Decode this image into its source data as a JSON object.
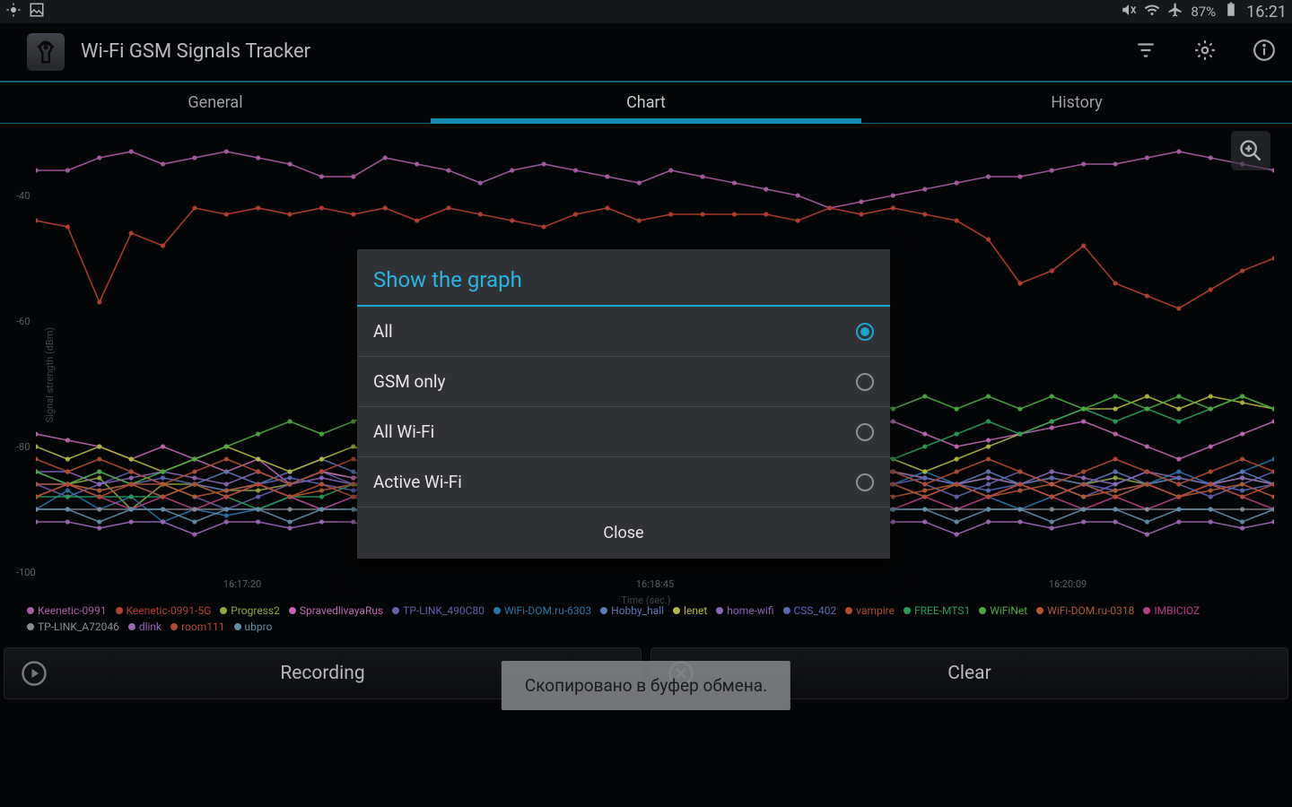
{
  "status": {
    "battery_pct": "87%",
    "time": "16:21"
  },
  "app": {
    "title": "Wi-Fi GSM Signals Tracker"
  },
  "tabs": {
    "general": "General",
    "chart": "Chart",
    "history": "History",
    "active": "chart"
  },
  "dialog": {
    "title": "Show the graph",
    "options": [
      "All",
      "GSM only",
      "All Wi-Fi",
      "Active Wi-Fi"
    ],
    "selected": 0,
    "close": "Close"
  },
  "buttons": {
    "record": "Recording",
    "clear": "Clear"
  },
  "toast": "Скопировано в буфер обмена.",
  "chart_data": {
    "type": "line",
    "xlabel": "Time (sec.)",
    "ylabel": "Signal strength (dBm)",
    "ylim": [
      -100,
      -30
    ],
    "yticks": [
      -40,
      -60,
      -80,
      -100
    ],
    "xticks": [
      "16:17:20",
      "16:18:45",
      "16:20:09"
    ],
    "series": [
      {
        "name": "Keenetic-0991",
        "color": "#c86fc1",
        "values": [
          -36,
          -36,
          -34,
          -33,
          -35,
          -34,
          -33,
          -34,
          -35,
          -37,
          -37,
          -34,
          -35,
          -36,
          -38,
          -36,
          -35,
          -36,
          -37,
          -38,
          -36,
          -37,
          -38,
          -39,
          -40,
          -42,
          -41,
          -40,
          -39,
          -38,
          -37,
          -37,
          -36,
          -35,
          -35,
          -34,
          -33,
          -34,
          -35,
          -36
        ]
      },
      {
        "name": "Keenetic-0991-5G",
        "color": "#d84b3a",
        "values": [
          -44,
          -45,
          -57,
          -46,
          -48,
          -42,
          -43,
          -42,
          -43,
          -42,
          -43,
          -42,
          -44,
          -42,
          -43,
          -44,
          -45,
          -43,
          -42,
          -44,
          -43,
          -43,
          -43,
          -43,
          -44,
          -42,
          -43,
          -42,
          -43,
          -44,
          -47,
          -54,
          -52,
          -48,
          -54,
          -56,
          -58,
          -55,
          -52,
          -50
        ]
      },
      {
        "name": "Progress2",
        "color": "#a8c84a",
        "values": [
          -88,
          -86,
          -85,
          -90,
          -86,
          -86,
          -87,
          -87,
          -86,
          -84,
          -85,
          -84,
          -85,
          -86,
          -85,
          -86,
          -87,
          -86,
          -85,
          -86,
          -85,
          -86,
          -87,
          -86,
          -85,
          -86,
          -85,
          -84,
          -85,
          -86,
          -85,
          -86,
          -85,
          -86,
          -85,
          -86,
          -85,
          -86,
          -85,
          -86
        ]
      },
      {
        "name": "SpravedlivayaRus",
        "color": "#e07ad2",
        "values": [
          -78,
          -79,
          -80,
          -82,
          -80,
          -82,
          -84,
          -82,
          -86,
          -84,
          -85,
          -84,
          -85,
          -86,
          -85,
          -86,
          -85,
          -86,
          -85,
          -86,
          -85,
          -84,
          -83,
          -82,
          -80,
          -78,
          -77,
          -76,
          -78,
          -80,
          -79,
          -78,
          -77,
          -76,
          -78,
          -80,
          -82,
          -80,
          -78,
          -76
        ]
      },
      {
        "name": "TP-LINK_490C80",
        "color": "#7a6fc8",
        "values": [
          -86,
          -88,
          -86,
          -84,
          -86,
          -88,
          -90,
          -88,
          -86,
          -84,
          -86,
          -88,
          -86,
          -88,
          -86,
          -84,
          -86,
          -88,
          -86,
          -84,
          -86,
          -88,
          -86,
          -84,
          -86,
          -84,
          -82,
          -84,
          -86,
          -88,
          -86,
          -84,
          -86,
          -88,
          -86,
          -84,
          -86,
          -88,
          -86,
          -84
        ]
      },
      {
        "name": "WiFi-DOM.ru-6303",
        "color": "#2f8ac8",
        "values": [
          -90,
          -87,
          -90,
          -88,
          -92,
          -90,
          -91,
          -90,
          -88,
          -90,
          -88,
          -86,
          -88,
          -90,
          -88,
          -90,
          -88,
          -86,
          -88,
          -90,
          -92,
          -90,
          -88,
          -90,
          -88,
          -86,
          -88,
          -86,
          -84,
          -86,
          -88,
          -90,
          -88,
          -86,
          -88,
          -86,
          -84,
          -86,
          -84,
          -82
        ]
      },
      {
        "name": "Hobby_hall",
        "color": "#6f8cd6",
        "values": [
          -84,
          -86,
          -84,
          -86,
          -88,
          -86,
          -84,
          -86,
          -84,
          -82,
          -84,
          -86,
          -88,
          -86,
          -84,
          -86,
          -88,
          -86,
          -84,
          -86,
          -88,
          -86,
          -84,
          -86,
          -88,
          -86,
          -84,
          -86,
          -88,
          -86,
          -84,
          -86,
          -88,
          -86,
          -84,
          -86,
          -88,
          -86,
          -84,
          -86
        ]
      },
      {
        "name": "lenet",
        "color": "#d0d84a",
        "values": [
          -80,
          -82,
          -80,
          -82,
          -84,
          -82,
          -80,
          -82,
          -84,
          -82,
          -80,
          -82,
          -84,
          -82,
          -80,
          -82,
          -84,
          -82,
          -80,
          -82,
          -84,
          -82,
          -80,
          -82,
          -84,
          -82,
          -80,
          -82,
          -84,
          -82,
          -80,
          -78,
          -76,
          -74,
          -74,
          -72,
          -74,
          -72,
          -73,
          -74
        ]
      },
      {
        "name": "home-wifi",
        "color": "#a27ad6",
        "values": [
          -84,
          -84,
          -86,
          -85,
          -84,
          -85,
          -86,
          -84,
          -86,
          -85,
          -86,
          -85,
          -84,
          -85,
          -86,
          -84,
          -85,
          -86,
          -85,
          -86,
          -84,
          -85,
          -84,
          -85,
          -84,
          -85,
          -86,
          -84,
          -85,
          -86,
          -85,
          -86,
          -84,
          -85,
          -86,
          -84,
          -85,
          -86,
          -85,
          -86
        ]
      },
      {
        "name": "CSS_402",
        "color": "#6c7ad8",
        "values": [
          -86,
          -86,
          -87,
          -86,
          -85,
          -86,
          -87,
          -86,
          -85,
          -86,
          -87,
          -86,
          -85,
          -86,
          -87,
          -86,
          -85,
          -86,
          -87,
          -86,
          -85,
          -86,
          -87,
          -86,
          -85,
          -86,
          -87,
          -86,
          -85,
          -86,
          -87,
          -86,
          -85,
          -86,
          -87,
          -86,
          -85,
          -86,
          -87,
          -86
        ]
      },
      {
        "name": "vampire",
        "color": "#d05a3a",
        "values": [
          -82,
          -84,
          -82,
          -84,
          -86,
          -84,
          -82,
          -84,
          -86,
          -84,
          -82,
          -84,
          -86,
          -84,
          -82,
          -84,
          -86,
          -84,
          -82,
          -84,
          -86,
          -84,
          -82,
          -84,
          -86,
          -84,
          -82,
          -84,
          -86,
          -84,
          -82,
          -84,
          -86,
          -84,
          -82,
          -84,
          -86,
          -84,
          -82,
          -84
        ]
      },
      {
        "name": "FREE-MTS1",
        "color": "#2fb86a",
        "values": [
          -88,
          -88,
          -88,
          -88,
          -88,
          -86,
          -88,
          -90,
          -88,
          -88,
          -86,
          -88,
          -88,
          -90,
          -88,
          -88,
          -88,
          -90,
          -88,
          -88,
          -88,
          -86,
          -84,
          -86,
          -84,
          -82,
          -80,
          -82,
          -80,
          -78,
          -76,
          -78,
          -76,
          -74,
          -76,
          -74,
          -76,
          -74,
          -72,
          -74
        ]
      },
      {
        "name": "WiFiNet",
        "color": "#58c84a",
        "values": [
          -84,
          -86,
          -84,
          -86,
          -84,
          -82,
          -80,
          -78,
          -76,
          -78,
          -76,
          -74,
          -76,
          -78,
          -76,
          -74,
          -76,
          -78,
          -76,
          -74,
          -76,
          -74,
          -76,
          -74,
          -76,
          -74,
          -72,
          -74,
          -72,
          -74,
          -72,
          -74,
          -72,
          -74,
          -72,
          -74,
          -72,
          -74,
          -72,
          -74
        ]
      },
      {
        "name": "WiFi-DOM.ru-0318",
        "color": "#d06a3a",
        "values": [
          -86,
          -86,
          -87,
          -86,
          -86,
          -88,
          -87,
          -86,
          -88,
          -87,
          -86,
          -86,
          -88,
          -87,
          -86,
          -88,
          -87,
          -86,
          -88,
          -87,
          -86,
          -88,
          -87,
          -86,
          -88,
          -87,
          -86,
          -88,
          -87,
          -86,
          -88,
          -87,
          -86,
          -88,
          -87,
          -86,
          -88,
          -87,
          -86,
          -88
        ]
      },
      {
        "name": "IMBICIOZ",
        "color": "#d84a9a",
        "values": [
          -88,
          -86,
          -88,
          -90,
          -88,
          -90,
          -88,
          -86,
          -88,
          -90,
          -88,
          -90,
          -88,
          -86,
          -88,
          -90,
          -88,
          -90,
          -88,
          -86,
          -88,
          -90,
          -88,
          -90,
          -88,
          -86,
          -88,
          -90,
          -88,
          -90,
          -88,
          -86,
          -88,
          -90,
          -88,
          -90,
          -88,
          -86,
          -88,
          -90
        ]
      },
      {
        "name": "TP-LINK_A72046",
        "color": "#a0a6ae",
        "values": [
          -90,
          -90,
          -90,
          -90,
          -90,
          -90,
          -90,
          -90,
          -90,
          -90,
          -90,
          -90,
          -90,
          -90,
          -90,
          -90,
          -90,
          -90,
          -90,
          -90,
          -90,
          -90,
          -90,
          -90,
          -90,
          -90,
          -90,
          -90,
          -90,
          -90,
          -90,
          -90,
          -90,
          -90,
          -90,
          -90,
          -90,
          -90,
          -90,
          -90
        ]
      },
      {
        "name": "dlink",
        "color": "#b87ad6",
        "values": [
          -92,
          -92,
          -93,
          -92,
          -92,
          -94,
          -92,
          -92,
          -93,
          -92,
          -92,
          -94,
          -92,
          -92,
          -93,
          -92,
          -92,
          -94,
          -92,
          -92,
          -93,
          -92,
          -92,
          -94,
          -92,
          -92,
          -93,
          -92,
          -92,
          -94,
          -92,
          -92,
          -93,
          -92,
          -92,
          -94,
          -92,
          -92,
          -93,
          -92
        ]
      },
      {
        "name": "room111",
        "color": "#d05a3a",
        "values": [
          -88,
          -86,
          -88,
          -86,
          -88,
          -86,
          -88,
          -86,
          -88,
          -86,
          -88,
          -86,
          -88,
          -86,
          -88,
          -86,
          -88,
          -86,
          -88,
          -86,
          -88,
          -86,
          -88,
          -86,
          -88,
          -86,
          -88,
          -86,
          -88,
          -86,
          -88,
          -86,
          -88,
          -86,
          -88,
          -86,
          -88,
          -86,
          -88,
          -86
        ]
      },
      {
        "name": "ubpro",
        "color": "#6fa8c8",
        "values": [
          -90,
          -90,
          -92,
          -90,
          -90,
          -92,
          -90,
          -90,
          -92,
          -90,
          -90,
          -92,
          -90,
          -90,
          -92,
          -90,
          -90,
          -92,
          -90,
          -90,
          -92,
          -90,
          -90,
          -92,
          -90,
          -90,
          -92,
          -90,
          -90,
          -92,
          -90,
          -90,
          -92,
          -90,
          -90,
          -92,
          -90,
          -90,
          -92,
          -90
        ]
      }
    ]
  }
}
